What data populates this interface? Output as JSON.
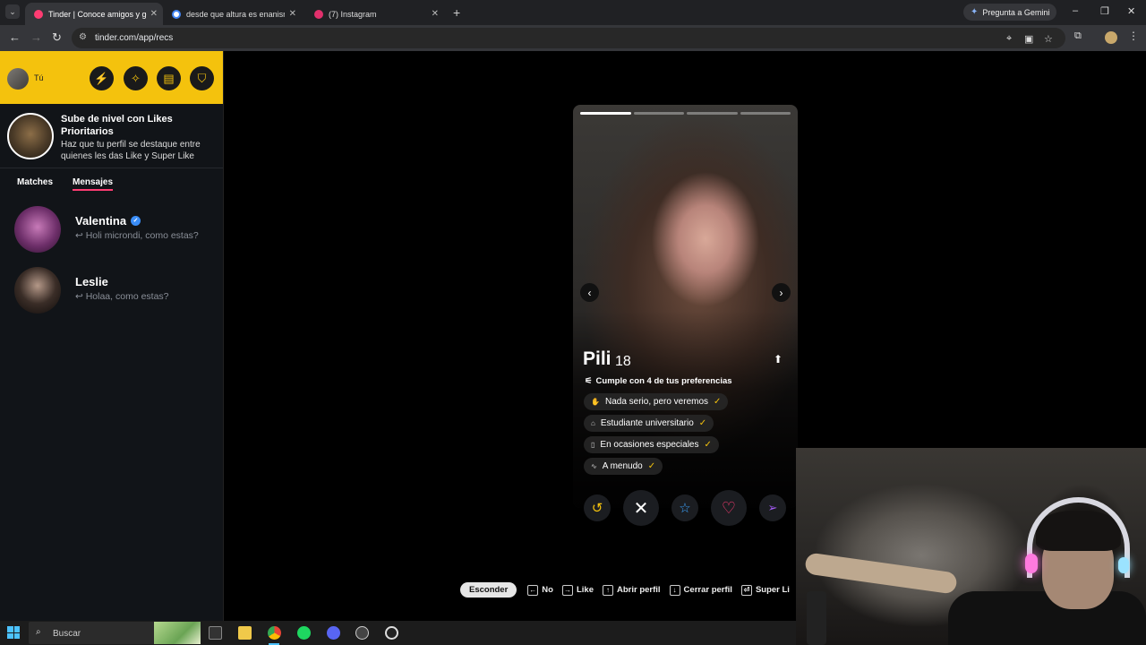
{
  "browser": {
    "tabs": [
      {
        "title": "Tinder | Conoce amigos y gente",
        "favicon_color": "#fe3c72",
        "active": true
      },
      {
        "title": "desde que altura es enanismo",
        "favicon_color": "#4285f4",
        "active": false
      },
      {
        "title": "(7) Instagram",
        "favicon_color": "#e1306c",
        "active": false
      }
    ],
    "gemini_label": "Pregunta a Gemini",
    "url": "tinder.com/app/recs"
  },
  "sidebar": {
    "me_label": "Tú",
    "header_buttons": [
      "bolt-icon",
      "compass-icon",
      "briefcase-icon",
      "shield-icon"
    ],
    "promo": {
      "title": "Sube de nivel con Likes Prioritarios",
      "text": "Haz que tu perfil se destaque entre quienes les das Like y Super Like"
    },
    "tabs": {
      "matches": "Matches",
      "messages": "Mensajes"
    },
    "messages": [
      {
        "name": "Valentina",
        "verified": true,
        "preview": "↩ Holi microndi, como estas?"
      },
      {
        "name": "Leslie",
        "verified": false,
        "preview": "↩ Holaa, como estas?"
      }
    ]
  },
  "profile": {
    "photo_count": 4,
    "active_photo": 1,
    "name": "Pili",
    "age": "18",
    "preferences": "Cumple con 4 de tus preferencias",
    "chips": [
      {
        "icon": "wave-icon",
        "label": "Nada serio, pero veremos"
      },
      {
        "icon": "graduation-cap-icon",
        "label": "Estudiante universitario"
      },
      {
        "icon": "glass-icon",
        "label": "En ocasiones especiales"
      },
      {
        "icon": "cigarette-icon",
        "label": "A menudo"
      }
    ]
  },
  "actions": [
    "rewind-icon",
    "nope-icon",
    "super-like-icon",
    "like-icon",
    "boost-icon"
  ],
  "hints": {
    "hide": "Esconder",
    "items": [
      {
        "key": "←",
        "label": "No"
      },
      {
        "key": "→",
        "label": "Like"
      },
      {
        "key": "↑",
        "label": "Abrir perfil"
      },
      {
        "key": "↓",
        "label": "Cerrar perfil"
      },
      {
        "key": "⏎",
        "label": "Super Li"
      }
    ]
  },
  "taskbar": {
    "search_placeholder": "Buscar"
  },
  "colors": {
    "tinder_pink": "#fe3c72",
    "gold": "#f4c20d",
    "verified_blue": "#3a8df7"
  }
}
